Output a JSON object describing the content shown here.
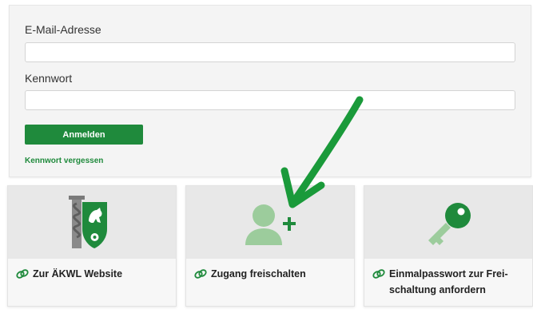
{
  "login": {
    "email_label": "E-Mail-Adresse",
    "email_value": "",
    "password_label": "Kennwort",
    "password_value": "",
    "submit_label": "Anmelden",
    "forgot_link": "Kennwort vergessen"
  },
  "tiles": [
    {
      "label": "Zur ÄKWL Website",
      "icon": "aekwl-crest-icon"
    },
    {
      "label": "Zugang freischalten",
      "icon": "user-add-icon"
    },
    {
      "label": "Einmalpasswort zur Frei-schaltung anfordern",
      "icon": "key-icon"
    }
  ],
  "colors": {
    "accent": "#1f8a3c",
    "tile_icon": "#9ccc9c",
    "card_background": "#f4f4f4",
    "tile_image_background": "#e8e8e8",
    "annotation_arrow": "#1a9a3a"
  },
  "annotation": {
    "icon": "arrow-annotation-icon"
  }
}
